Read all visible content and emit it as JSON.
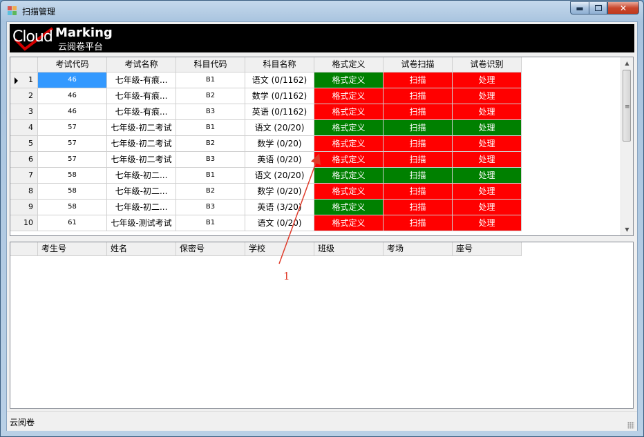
{
  "window": {
    "title": "扫描管理"
  },
  "banner": {
    "logo_cloud": "Cloud",
    "logo_marking": "Marking",
    "logo_sub": "云阅卷平台"
  },
  "exam_grid": {
    "columns": [
      "考试代码",
      "考试名称",
      "科目代码",
      "科目名称",
      "格式定义",
      "试卷扫描",
      "试卷识别"
    ],
    "rows": [
      {
        "num": "1",
        "code": "46",
        "name": "七年级-有痕...",
        "subject_code": "B1",
        "subject": "语文 (0/1162)",
        "format": "格式定义",
        "scan": "扫描",
        "recognize": "处理",
        "format_status": "green",
        "scan_status": "red",
        "recognize_status": "red"
      },
      {
        "num": "2",
        "code": "46",
        "name": "七年级-有痕...",
        "subject_code": "B2",
        "subject": "数学 (0/1162)",
        "format": "格式定义",
        "scan": "扫描",
        "recognize": "处理",
        "format_status": "red",
        "scan_status": "red",
        "recognize_status": "red"
      },
      {
        "num": "3",
        "code": "46",
        "name": "七年级-有痕...",
        "subject_code": "B3",
        "subject": "英语 (0/1162)",
        "format": "格式定义",
        "scan": "扫描",
        "recognize": "处理",
        "format_status": "red",
        "scan_status": "red",
        "recognize_status": "red"
      },
      {
        "num": "4",
        "code": "57",
        "name": "七年级-初二考试",
        "subject_code": "B1",
        "subject": "语文 (20/20)",
        "format": "格式定义",
        "scan": "扫描",
        "recognize": "处理",
        "format_status": "green",
        "scan_status": "green",
        "recognize_status": "green"
      },
      {
        "num": "5",
        "code": "57",
        "name": "七年级-初二考试",
        "subject_code": "B2",
        "subject": "数学 (0/20)",
        "format": "格式定义",
        "scan": "扫描",
        "recognize": "处理",
        "format_status": "red",
        "scan_status": "red",
        "recognize_status": "red"
      },
      {
        "num": "6",
        "code": "57",
        "name": "七年级-初二考试",
        "subject_code": "B3",
        "subject": "英语 (0/20)",
        "format": "格式定义",
        "scan": "扫描",
        "recognize": "处理",
        "format_status": "red",
        "scan_status": "red",
        "recognize_status": "red"
      },
      {
        "num": "7",
        "code": "58",
        "name": "七年级-初二...",
        "subject_code": "B1",
        "subject": "语文 (20/20)",
        "format": "格式定义",
        "scan": "扫描",
        "recognize": "处理",
        "format_status": "green",
        "scan_status": "green",
        "recognize_status": "green"
      },
      {
        "num": "8",
        "code": "58",
        "name": "七年级-初二...",
        "subject_code": "B2",
        "subject": "数学 (0/20)",
        "format": "格式定义",
        "scan": "扫描",
        "recognize": "处理",
        "format_status": "red",
        "scan_status": "red",
        "recognize_status": "red"
      },
      {
        "num": "9",
        "code": "58",
        "name": "七年级-初二...",
        "subject_code": "B3",
        "subject": "英语 (3/20)",
        "format": "格式定义",
        "scan": "扫描",
        "recognize": "处理",
        "format_status": "green",
        "scan_status": "red",
        "recognize_status": "red"
      },
      {
        "num": "10",
        "code": "61",
        "name": "七年级-测试考试",
        "subject_code": "B1",
        "subject": "语文 (0/20)",
        "format": "格式定义",
        "scan": "扫描",
        "recognize": "处理",
        "format_status": "red",
        "scan_status": "red",
        "recognize_status": "red"
      }
    ]
  },
  "student_grid": {
    "columns": [
      "考生号",
      "姓名",
      "保密号",
      "学校",
      "班级",
      "考场",
      "座号"
    ]
  },
  "annotation": {
    "label": "1",
    "color": "#e03b2a"
  },
  "status_bar": {
    "text": "云阅卷"
  }
}
